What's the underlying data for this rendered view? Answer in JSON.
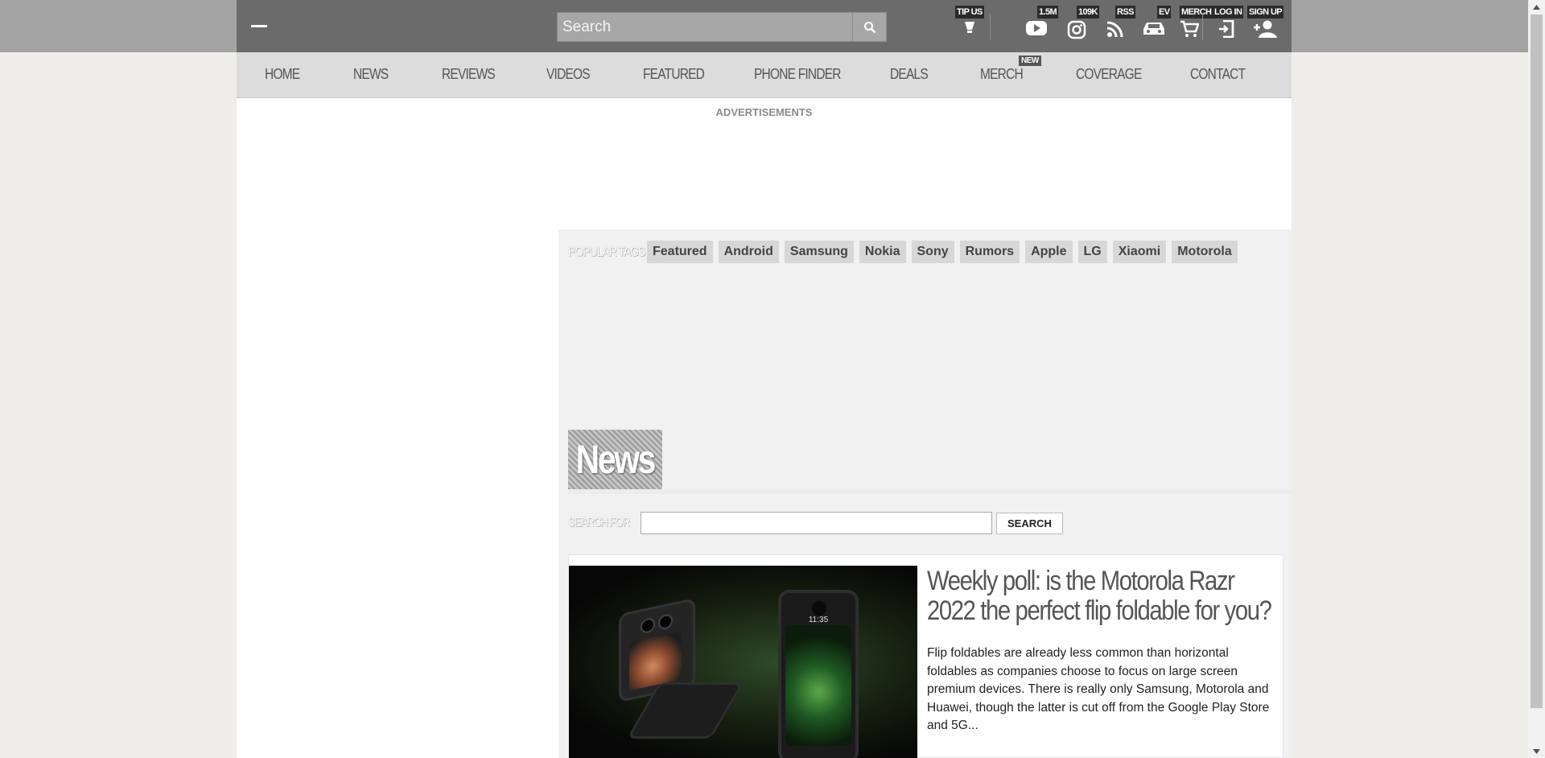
{
  "header": {
    "search_placeholder": "Search",
    "icons": [
      {
        "label": "TIP US",
        "icon": "lightbulb-icon"
      },
      {
        "label": "1.5M",
        "icon": "youtube-icon"
      },
      {
        "label": "109K",
        "icon": "instagram-icon"
      },
      {
        "label": "RSS",
        "icon": "rss-icon"
      },
      {
        "label": "EV",
        "icon": "car-icon"
      },
      {
        "label": "MERCH",
        "icon": "cart-icon"
      },
      {
        "label": "LOG IN",
        "icon": "login-icon"
      },
      {
        "label": "SIGN UP",
        "icon": "add-user-icon"
      }
    ]
  },
  "nav": {
    "items": [
      "HOME",
      "NEWS",
      "REVIEWS",
      "VIDEOS",
      "FEATURED",
      "PHONE FINDER",
      "DEALS",
      "MERCH",
      "COVERAGE",
      "CONTACT"
    ],
    "new_badge": "NEW"
  },
  "ads": {
    "label": "ADVERTISEMENTS"
  },
  "tags": {
    "label": "POPULAR TAGS",
    "items": [
      "Featured",
      "Android",
      "Samsung",
      "Nokia",
      "Sony",
      "Rumors",
      "Apple",
      "LG",
      "Xiaomi",
      "Motorola"
    ]
  },
  "section": {
    "title": "News"
  },
  "search_for": {
    "label": "SEARCH FOR",
    "button": "SEARCH"
  },
  "article": {
    "title": "Weekly poll: is the Motorola Razr 2022 the perfect flip foldable for you?",
    "excerpt": "Flip foldables are already less common than horizontal foldables as companies choose to focus on large screen premium devices. There is really only Samsung, Motorola and Huawei, though the latter is cut off from the Google Play Store and 5G...",
    "image_time": "11:35"
  },
  "colors": {
    "header_bg": "#6b6b6b",
    "nav_bg": "#dcdcdc",
    "content_bg": "#f1f1f1"
  }
}
